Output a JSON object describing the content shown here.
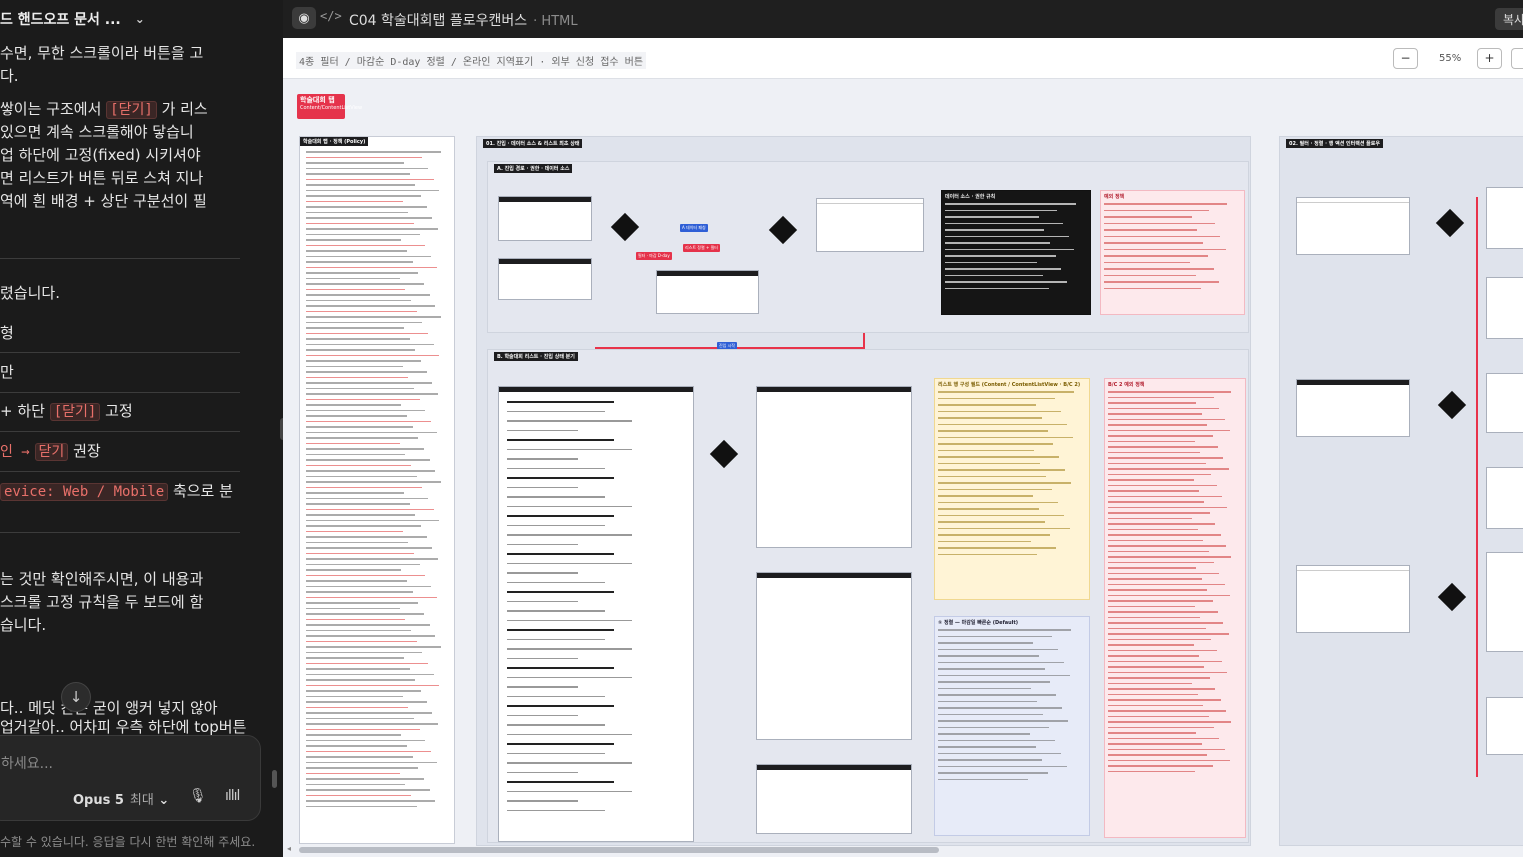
{
  "chat": {
    "thread_title": "드 핸드오프 문서 ...",
    "lines": [
      "수면, 무한 스크롤이라 버튼을 고",
      "다.",
      "쌓이는 구조에서",
      "있으면 계속 스크롤해야 닿습니",
      "업 하단에 고정(fixed) 시키셔야",
      "면 리스트가 버튼 뒤로 스쳐 지나",
      "역에 흰 배경 + 상단 구분선이 필",
      "렸습니다.",
      "형",
      "만",
      "+ 하단",
      "고정",
      "인 →",
      "권장",
      "축으로 분",
      "는 것만 확인해주시면, 이 내용과",
      "스크롤 고정 규칙을 두 보드에 함",
      "습니다.",
      "다.. 메딧 칸",
      "은 굳이 앵커 넣지 않아",
      "업거같아.. 어차피 우측 하단에 top버튼"
    ],
    "code_close": "[닫기]",
    "code_close2": "닫기",
    "code_close_tail": "가 리스",
    "code_device": "evice: Web / Mobile",
    "input_placeholder": "하세요...",
    "model_name": "Opus 5",
    "model_level": "최대",
    "disclaimer": "수할 수 있습니다. 응답을 다시 한번 확인해 주세요."
  },
  "preview": {
    "title": "C04 학술대회탭 플로우캔버스",
    "ext": "· HTML",
    "copy_label": "복사",
    "filter_note": "4종 필터 / 마감순 D-day 정렬 / 온라인 지역표기 · 외부 신청 접수 버튼",
    "zoom_minus": "−",
    "zoom_level": "55%",
    "zoom_plus": "+",
    "tag_title": "학술대회 탭",
    "tag_sub": "Content/ContentListView",
    "policy_head": "학술대회 탭 · 정책 (Policy)",
    "sec01_head": "01. 진입 · 데이터 소스 & 리스트 최초 상태",
    "secA_head": "A. 진입 경로 · 권한 · 데이터 소스",
    "secB_head": "B. 학술대회 리스트 · 진입 상태 분기",
    "sec02_head": "02. 필터 · 정렬 · 행 액션 인터랙션 플로우",
    "lbl_1": "A 데이터 패칭",
    "lbl_2": "필터 · 마감 D-day",
    "lbl_3": "리스트 정렬 + 필터",
    "lbl_4": "진입 시작",
    "black_note_title": "데이터 소스 · 권한 규칙",
    "pink_note_title": "예외 정책",
    "yellow_note_title": "리스트 행 구성 필드 (Content / ContentListView · B/C 2)",
    "pink2_note_title": "B/C 2 예외 정책",
    "blue_note_title": "① 정렬 — 마감일 빠른순 (Default)"
  }
}
